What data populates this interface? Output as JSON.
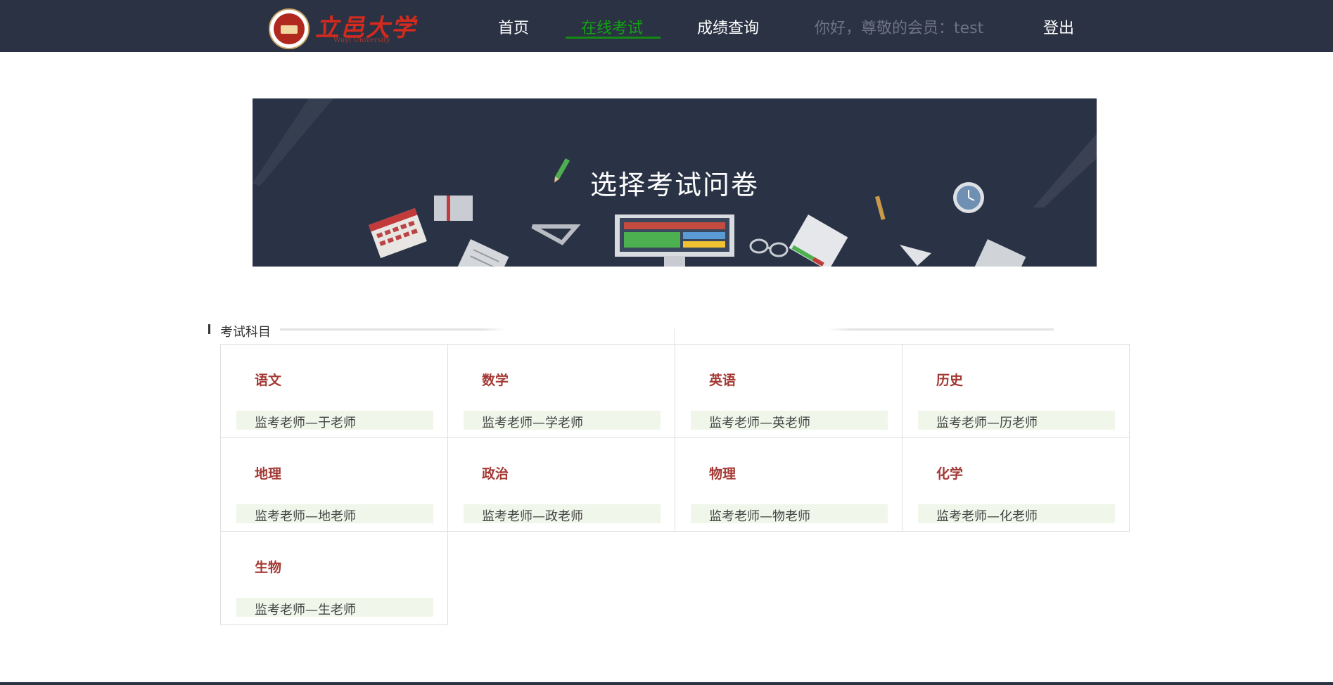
{
  "navbar": {
    "logo_text": "立邑大学",
    "logo_subtext": "Wuyi University",
    "items": [
      {
        "label": "首页",
        "active": false
      },
      {
        "label": "在线考试",
        "active": true
      },
      {
        "label": "成绩查询",
        "active": false
      }
    ],
    "greeting": "你好，尊敬的会员：test",
    "logout_label": "登出",
    "colors": {
      "background": "#2a3243",
      "active": "#12a312"
    }
  },
  "banner": {
    "title": "选择考试问卷"
  },
  "section": {
    "title": "考试科目"
  },
  "subjects": [
    {
      "name": "语文",
      "teacher": "监考老师—于老师"
    },
    {
      "name": "数学",
      "teacher": "监考老师—学老师"
    },
    {
      "name": "英语",
      "teacher": "监考老师—英老师"
    },
    {
      "name": "历史",
      "teacher": "监考老师—历老师"
    },
    {
      "name": "地理",
      "teacher": "监考老师—地老师"
    },
    {
      "name": "政治",
      "teacher": "监考老师—政老师"
    },
    {
      "name": "物理",
      "teacher": "监考老师—物老师"
    },
    {
      "name": "化学",
      "teacher": "监考老师—化老师"
    },
    {
      "name": "生物",
      "teacher": "监考老师—生老师"
    }
  ]
}
